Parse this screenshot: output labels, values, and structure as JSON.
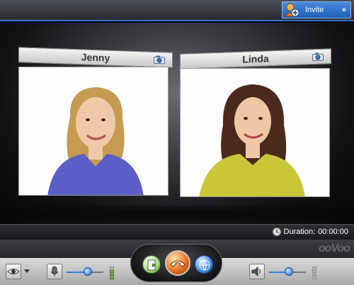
{
  "titlebar": {
    "invite_label": "Invite",
    "invite_chevron": "»"
  },
  "participants": [
    {
      "name": "Jenny",
      "icon": "camera-icon",
      "shirt_color": "#5a5ec6",
      "hair_color": "#c79a52"
    },
    {
      "name": "Linda",
      "icon": "camera-icon",
      "shirt_color": "#c9c63a",
      "hair_color": "#4a2a1a"
    }
  ],
  "status": {
    "duration_label": "Duration:",
    "duration_value": "00:00:00"
  },
  "controls": {
    "view_icon": "eye-icon",
    "mic_icon": "microphone-icon",
    "mic_level": 0.55,
    "speaker_icon": "speaker-icon",
    "speaker_level": 0.55,
    "center_buttons": [
      "share-icon",
      "hangup-phone-icon",
      "globe-icon"
    ],
    "brand_logo": "ooVoo"
  },
  "colors": {
    "accent": "#3a76c8",
    "level_green": "#7ac24a",
    "hangup_orange": "#e86a1a"
  }
}
